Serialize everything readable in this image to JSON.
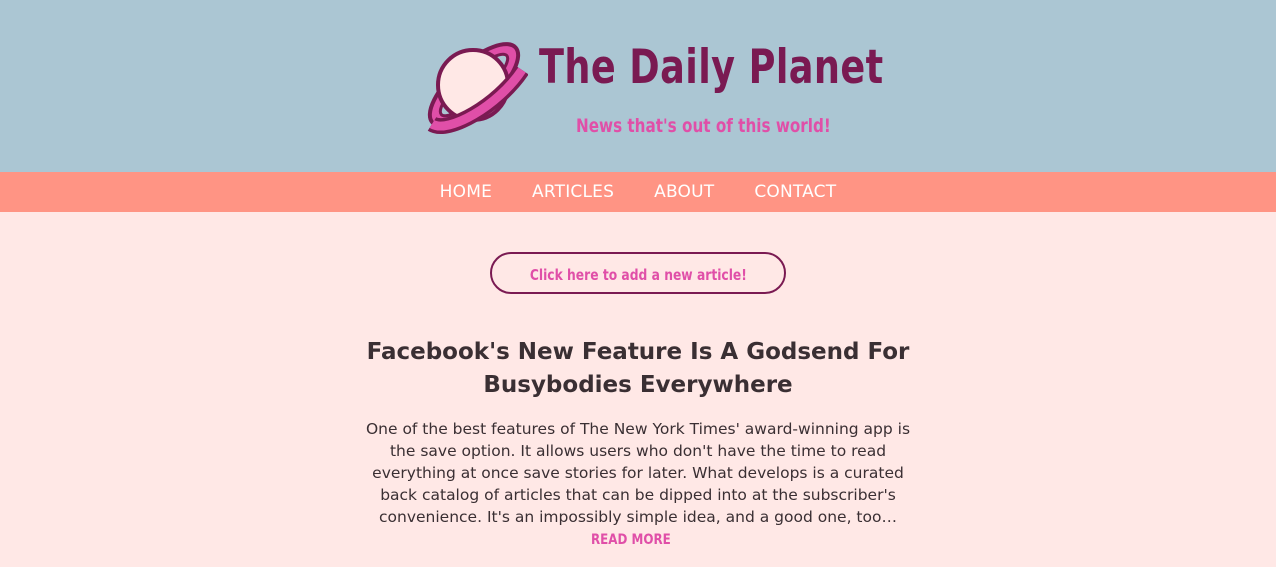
{
  "header": {
    "logo_icon": "planet-icon",
    "title": "The Daily Planet",
    "tagline": "News that's out of this world!"
  },
  "nav": {
    "items": [
      {
        "label": "HOME"
      },
      {
        "label": "ARTICLES"
      },
      {
        "label": "ABOUT"
      },
      {
        "label": "CONTACT"
      }
    ]
  },
  "cta": {
    "label": "Click here to add a new article!"
  },
  "article": {
    "title": "Facebook's New Feature Is A Godsend For Busybodies Everywhere",
    "excerpt": "One of the best features of The New York Times' award-winning app is the save option. It allows users who don't have the time to read everything at once save stories for later. What develops is a curated back catalog of articles that can be dipped into at the subscriber's convenience. It's an impossibly simple idea, and a good one, too…",
    "read_more": "READ MORE"
  },
  "colors": {
    "header_bg": "#abc6d3",
    "nav_bg": "#ff9484",
    "page_bg": "#ffe8e6",
    "title": "#7a1a52",
    "accent": "#e04fa8",
    "text": "#3a2f33"
  }
}
